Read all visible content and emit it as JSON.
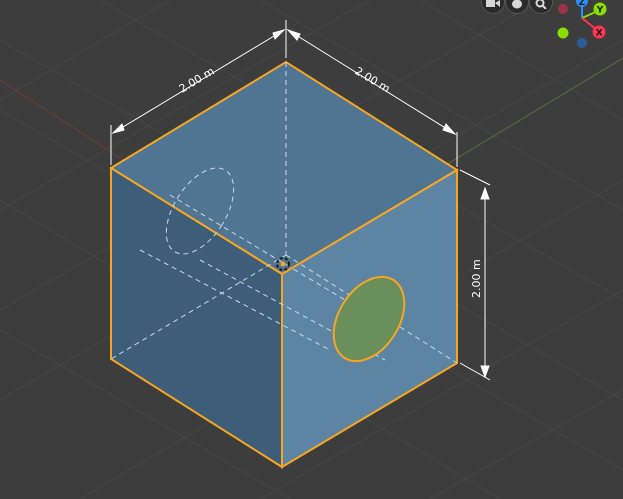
{
  "viewport": {
    "background": "#3d3d3d",
    "grid_color": "#474747"
  },
  "toolbar": {
    "icons": [
      "camera-icon",
      "hand-pan-icon",
      "zoom-icon"
    ]
  },
  "gizmo": {
    "z_label": "Z",
    "y_label": "Y",
    "x_label": "X",
    "colors": {
      "x": "#ff3352",
      "y": "#8bdc00",
      "z": "#2890ff"
    }
  },
  "cube": {
    "edge_color": "#f5a623",
    "top_color": "#4f7592",
    "left_color": "#3e5d78",
    "right_color": "#5d84a3",
    "hole_fill": "#6b8f5a"
  },
  "dimensions": {
    "width_label": "2.00 m",
    "depth_label": "2.00 m",
    "height_label": "2.00 m"
  }
}
